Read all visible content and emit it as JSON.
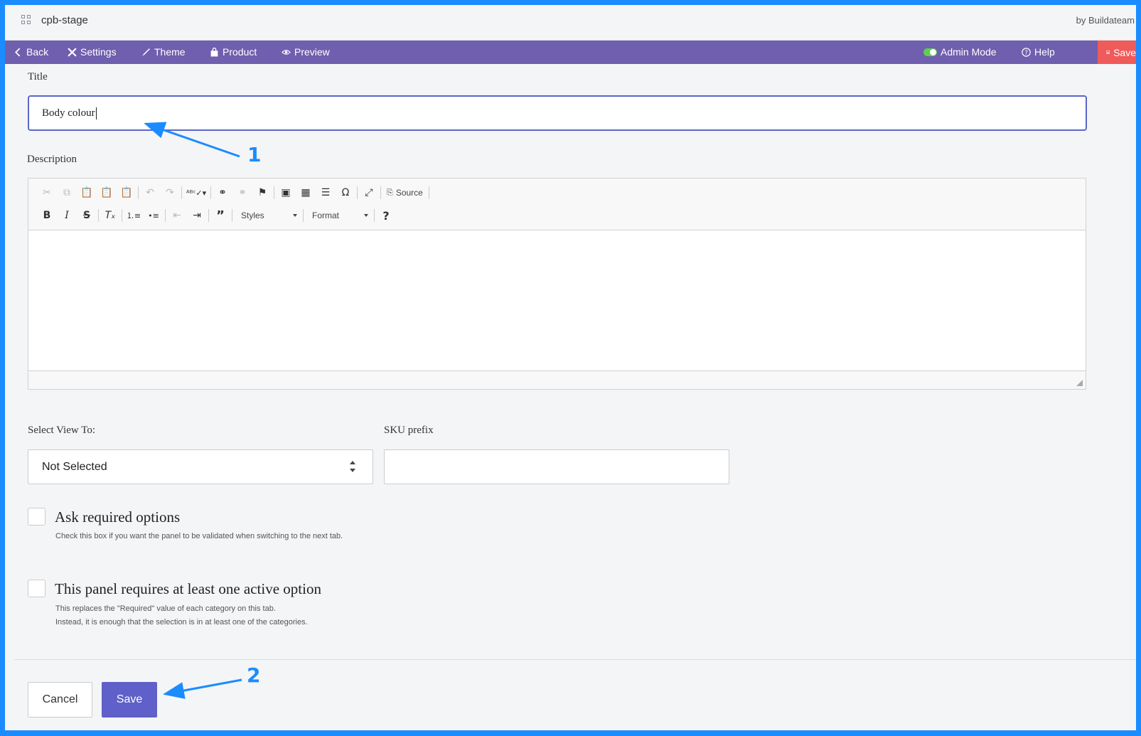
{
  "topbar": {
    "app_name": "cpb-stage",
    "brand": "by Buildateam",
    "app_icon": "grid-icon"
  },
  "nav": {
    "back": "Back",
    "settings": "Settings",
    "theme": "Theme",
    "product": "Product",
    "preview": "Preview",
    "admin_mode": "Admin Mode",
    "help": "Help",
    "save": "Save"
  },
  "form": {
    "title_label": "Title",
    "title_value": "Body colour",
    "description_label": "Description",
    "select_view_label": "Select View To:",
    "select_view_value": "Not Selected",
    "sku_prefix_label": "SKU prefix",
    "sku_prefix_value": "",
    "ask_required": {
      "title": "Ask required options",
      "help": "Check this box if you want the panel to be validated when switching to the next tab.",
      "checked": false
    },
    "requires_active": {
      "title": "This panel requires at least one active option",
      "help_line1": "This replaces the \"Required\" value of each category on this tab.",
      "help_line2": "Instead, it is enough that the selection is in at least one of the categories.",
      "checked": false
    }
  },
  "editor_toolbar": {
    "source": "Source",
    "styles": "Styles",
    "format": "Format",
    "help": "?"
  },
  "buttons": {
    "cancel": "Cancel",
    "save": "Save"
  },
  "annotations": {
    "one": "1",
    "two": "2"
  },
  "colors": {
    "nav_bg": "#6f5fae",
    "accent": "#5f60c9",
    "save_red": "#ef5a5a",
    "annotation_blue": "#1a8cff",
    "toggle_green": "#5ed04e"
  }
}
